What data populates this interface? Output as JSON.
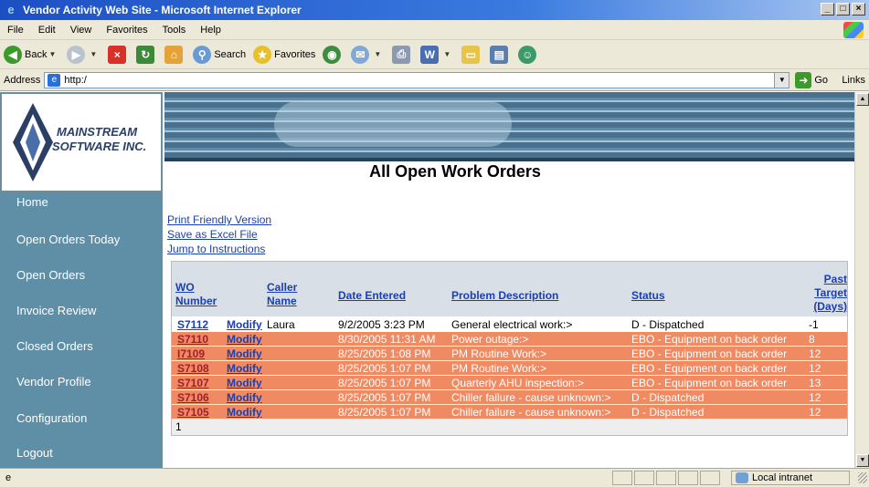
{
  "window": {
    "title": "Vendor Activity Web Site - Microsoft Internet Explorer",
    "controls": [
      "_",
      "□",
      "×"
    ]
  },
  "menu": [
    "File",
    "Edit",
    "View",
    "Favorites",
    "Tools",
    "Help"
  ],
  "toolbar": {
    "back_label": "Back",
    "search_label": "Search",
    "favorites_label": "Favorites"
  },
  "address": {
    "label": "Address",
    "value": "http:/",
    "go_label": "Go",
    "links_label": "Links"
  },
  "logo": {
    "line1": "MAINSTREAM",
    "line2": "SOFTWARE INC."
  },
  "sidebar": {
    "items": [
      {
        "label": "Home"
      },
      {
        "label": "Open Orders Today"
      },
      {
        "label": "Open Orders"
      },
      {
        "label": "Invoice Review"
      },
      {
        "label": "Closed Orders"
      },
      {
        "label": "Vendor Profile"
      },
      {
        "label": "Configuration"
      },
      {
        "label": "Logout"
      }
    ]
  },
  "page": {
    "title": "All Open Work Orders",
    "links": [
      "Print Friendly Version",
      "Save as Excel File",
      "Jump to Instructions"
    ]
  },
  "orders": {
    "headers": {
      "wo_line1": "WO",
      "wo_line2": "Number",
      "caller_line1": "Caller",
      "caller_line2": "Name",
      "date": "Date Entered",
      "problem": "Problem Description",
      "status": "Status",
      "past_line1": "Past",
      "past_line2": "Target",
      "past_line3": "(Days)"
    },
    "rows": [
      {
        "wo": "S7112",
        "action": "Modify",
        "caller": "Laura",
        "date": "9/2/2005 3:23 PM",
        "problem": "General electrical work:>",
        "status": "D - Dispatched",
        "past": "-1",
        "highlight": false
      },
      {
        "wo": "S7110",
        "action": "Modify",
        "caller": "",
        "date": "8/30/2005 11:31 AM",
        "problem": "Power outage:>",
        "status": "EBO - Equipment on back order",
        "past": "8",
        "highlight": true
      },
      {
        "wo": "I7109",
        "action": "Modify",
        "caller": "",
        "date": "8/25/2005 1:08 PM",
        "problem": "PM Routine Work:>",
        "status": "EBO - Equipment on back order",
        "past": "12",
        "highlight": true
      },
      {
        "wo": "S7108",
        "action": "Modify",
        "caller": "",
        "date": "8/25/2005 1:07 PM",
        "problem": "PM Routine Work:>",
        "status": "EBO - Equipment on back order",
        "past": "12",
        "highlight": true
      },
      {
        "wo": "S7107",
        "action": "Modify",
        "caller": "",
        "date": "8/25/2005 1:07 PM",
        "problem": "Quarterly AHU inspection:>",
        "status": "EBO - Equipment on back order",
        "past": "13",
        "highlight": true
      },
      {
        "wo": "S7106",
        "action": "Modify",
        "caller": "",
        "date": "8/25/2005 1:07 PM",
        "problem": "Chiller failure - cause unknown:>",
        "status": "D - Dispatched",
        "past": "12",
        "highlight": true
      },
      {
        "wo": "S7105",
        "action": "Modify",
        "caller": "",
        "date": "8/25/2005 1:07 PM",
        "problem": "Chiller failure - cause unknown:>",
        "status": "D - Dispatched",
        "past": "12",
        "highlight": true
      }
    ],
    "pager": "1"
  },
  "status": {
    "zone": "Local intranet"
  },
  "colors": {
    "sidebar": "#5e8fa6",
    "highlight_row": "#f08a62",
    "link": "#1a3fb0"
  }
}
